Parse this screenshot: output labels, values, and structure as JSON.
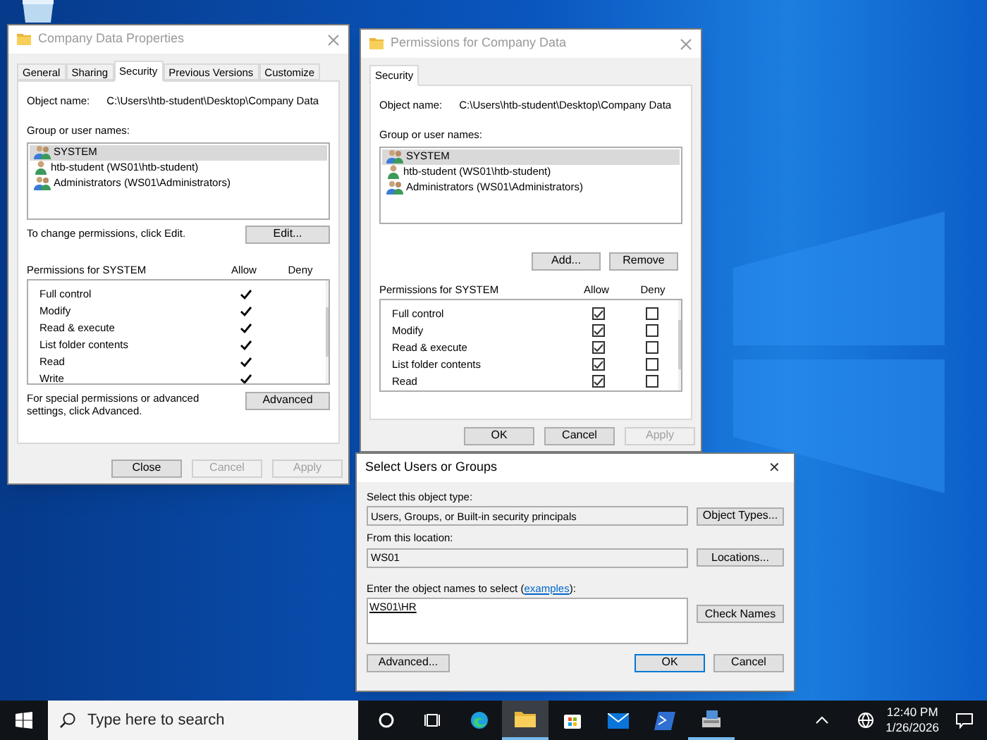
{
  "properties_window": {
    "title": "Company Data Properties",
    "tabs": [
      {
        "label": "General",
        "selected": false
      },
      {
        "label": "Sharing",
        "selected": false
      },
      {
        "label": "Security",
        "selected": true
      },
      {
        "label": "Previous Versions",
        "selected": false
      },
      {
        "label": "Customize",
        "selected": false
      }
    ],
    "object_label": "Object name:",
    "object_value": "C:\\Users\\htb-student\\Desktop\\Company Data",
    "group_label": "Group or user names:",
    "users": [
      {
        "kind": "group",
        "name": "SYSTEM",
        "selected": true
      },
      {
        "kind": "user",
        "name": "htb-student (WS01\\htb-student)",
        "selected": false
      },
      {
        "kind": "group",
        "name": "Administrators (WS01\\Administrators)",
        "selected": false
      }
    ],
    "change_text": "To change permissions, click Edit.",
    "edit_button": "Edit...",
    "permissions_header": "Permissions for SYSTEM",
    "allow_header": "Allow",
    "deny_header": "Deny",
    "permissions": [
      {
        "name": "Full control",
        "allow": true,
        "deny": false
      },
      {
        "name": "Modify",
        "allow": true,
        "deny": false
      },
      {
        "name": "Read & execute",
        "allow": true,
        "deny": false
      },
      {
        "name": "List folder contents",
        "allow": true,
        "deny": false
      },
      {
        "name": "Read",
        "allow": true,
        "deny": false
      },
      {
        "name": "Write",
        "allow": true,
        "deny": false
      }
    ],
    "advanced_text": "For special permissions or advanced settings, click Advanced.",
    "advanced_button": "Advanced",
    "buttons": [
      {
        "label": "Close",
        "disabled": false
      },
      {
        "label": "Cancel",
        "disabled": true
      },
      {
        "label": "Apply",
        "disabled": true
      }
    ]
  },
  "permissions_window": {
    "title": "Permissions for Company Data",
    "tabs": [
      {
        "label": "Security",
        "selected": true
      }
    ],
    "object_label": "Object name:",
    "object_value": "C:\\Users\\htb-student\\Desktop\\Company Data",
    "group_label": "Group or user names:",
    "users": [
      {
        "kind": "group",
        "name": "SYSTEM",
        "selected": true
      },
      {
        "kind": "user",
        "name": "htb-student (WS01\\htb-student)",
        "selected": false
      },
      {
        "kind": "group",
        "name": "Administrators (WS01\\Administrators)",
        "selected": false
      }
    ],
    "add_button": "Add...",
    "remove_button": "Remove",
    "permissions_header": "Permissions for SYSTEM",
    "allow_header": "Allow",
    "deny_header": "Deny",
    "permissions": [
      {
        "name": "Full control",
        "allow": true,
        "deny": false
      },
      {
        "name": "Modify",
        "allow": true,
        "deny": false
      },
      {
        "name": "Read & execute",
        "allow": true,
        "deny": false
      },
      {
        "name": "List folder contents",
        "allow": true,
        "deny": false
      },
      {
        "name": "Read",
        "allow": true,
        "deny": false
      }
    ],
    "buttons": [
      {
        "label": "OK",
        "disabled": false
      },
      {
        "label": "Cancel",
        "disabled": false
      },
      {
        "label": "Apply",
        "disabled": true
      }
    ]
  },
  "select_dialog": {
    "title": "Select Users or Groups",
    "close": "✕",
    "object_type_label": "Select this object type:",
    "object_type_value": "Users, Groups, or Built-in security principals",
    "object_types_button": "Object Types...",
    "location_label": "From this location:",
    "location_value": "WS01",
    "locations_button": "Locations...",
    "names_label": "Enter the object names to select (",
    "names_link": "examples",
    "names_label_end": "):",
    "names_value": "WS01\\HR",
    "check_names_button": "Check Names",
    "advanced_button": "Advanced...",
    "ok_button": "OK",
    "cancel_button": "Cancel"
  },
  "taskbar": {
    "search_placeholder": "Type here to search",
    "apps": [
      {
        "kind": "cortana",
        "active": false,
        "open": false
      },
      {
        "kind": "taskview",
        "active": false,
        "open": false
      },
      {
        "kind": "edge",
        "active": false,
        "open": false
      },
      {
        "kind": "explorer",
        "active": true,
        "open": true
      },
      {
        "kind": "store",
        "active": false,
        "open": false
      },
      {
        "kind": "mail",
        "active": false,
        "open": false
      },
      {
        "kind": "powershell",
        "active": false,
        "open": false
      },
      {
        "kind": "server",
        "active": false,
        "open": true
      }
    ],
    "time": "12:40 PM",
    "date": "1/26/2026"
  }
}
